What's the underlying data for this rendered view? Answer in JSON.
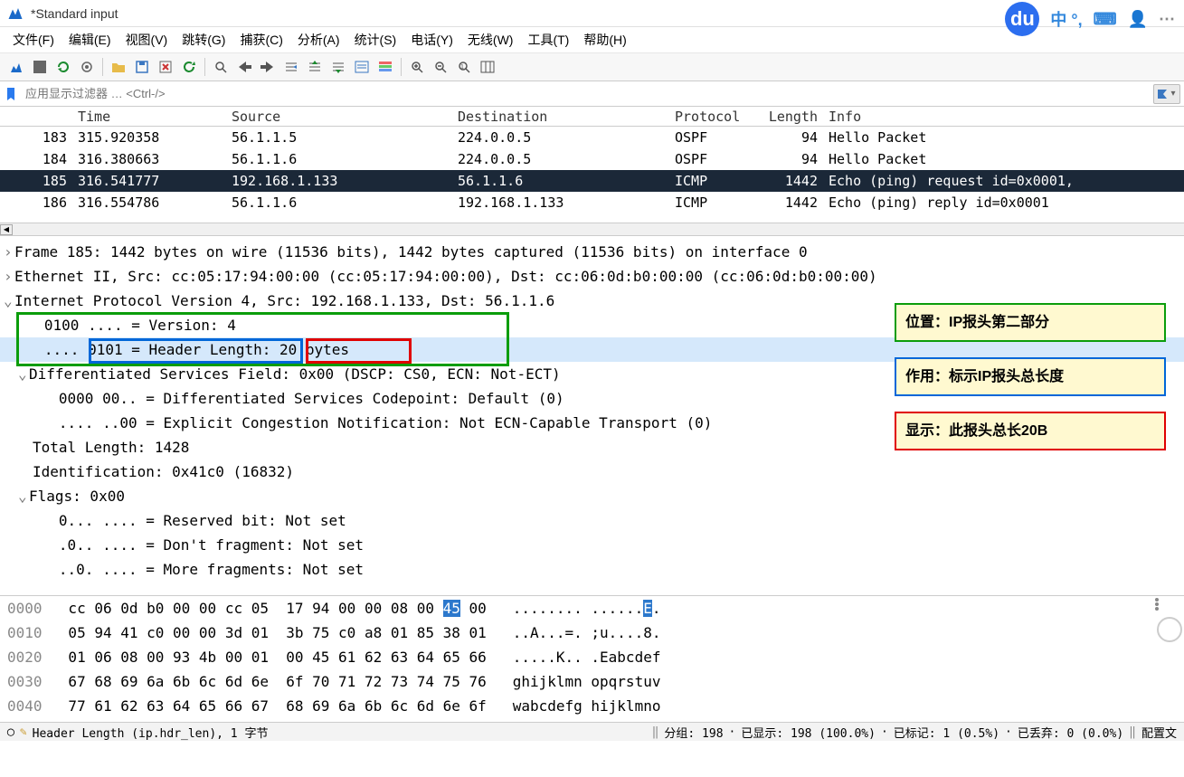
{
  "title": "*Standard input",
  "title_right": {
    "du": "du",
    "ime": "中 °,",
    "kb": "⌨",
    "user": "👤",
    "more": "⋯"
  },
  "menu": [
    "文件(F)",
    "编辑(E)",
    "视图(V)",
    "跳转(G)",
    "捕获(C)",
    "分析(A)",
    "统计(S)",
    "电话(Y)",
    "无线(W)",
    "工具(T)",
    "帮助(H)"
  ],
  "filter_placeholder": "应用显示过滤器 … <Ctrl-/>",
  "columns": [
    "",
    "Time",
    "Source",
    "Destination",
    "Protocol",
    "Length",
    "Info"
  ],
  "packets": [
    {
      "no": "183",
      "time": "315.920358",
      "src": "56.1.1.5",
      "dst": "224.0.0.5",
      "proto": "OSPF",
      "len": "94",
      "info": "Hello Packet"
    },
    {
      "no": "184",
      "time": "316.380663",
      "src": "56.1.1.6",
      "dst": "224.0.0.5",
      "proto": "OSPF",
      "len": "94",
      "info": "Hello Packet"
    },
    {
      "no": "185",
      "time": "316.541777",
      "src": "192.168.1.133",
      "dst": "56.1.1.6",
      "proto": "ICMP",
      "len": "1442",
      "info": "Echo (ping) request  id=0x0001,",
      "sel": true
    },
    {
      "no": "186",
      "time": "316.554786",
      "src": "56.1.1.6",
      "dst": "192.168.1.133",
      "proto": "ICMP",
      "len": "1442",
      "info": "Echo (ping) reply    id=0x0001"
    }
  ],
  "details": {
    "frame": "Frame 185: 1442 bytes on wire (11536 bits), 1442 bytes captured (11536 bits) on interface 0",
    "eth": "Ethernet II, Src: cc:05:17:94:00:00 (cc:05:17:94:00:00), Dst: cc:06:0d:b0:00:00 (cc:06:0d:b0:00:00)",
    "ip": "Internet Protocol Version 4, Src: 192.168.1.133, Dst: 56.1.1.6",
    "version": "   0100 .... = Version: 4",
    "hdr_prefix": "   .... ",
    "hdr_mid": "0101 = Header Length:",
    "hdr_val": " 20 bytes",
    "dsf": "Differentiated Services Field: 0x00 (DSCP: CS0, ECN: Not-ECT)",
    "dscp": "   0000 00.. = Differentiated Services Codepoint: Default (0)",
    "ecn": "   .... ..00 = Explicit Congestion Notification: Not ECN-Capable Transport (0)",
    "total_len": "Total Length: 1428",
    "ident": "Identification: 0x41c0 (16832)",
    "flags": "Flags: 0x00",
    "resv": "   0... .... = Reserved bit: Not set",
    "df": "   .0.. .... = Don't fragment: Not set",
    "mf": "   ..0. .... = More fragments: Not set"
  },
  "annotations": {
    "green": "位置：IP报头第二部分",
    "blue": "作用：标示IP报头总长度",
    "red": "显示：此报头总长20B"
  },
  "hex": [
    {
      "off": "0000",
      "b": "cc 06 0d b0 00 00 cc 05  17 94 00 00 08 00 ",
      "hl": "45",
      "b2": " 00",
      "a": "   ........ ......",
      "ah": "E",
      "a2": "."
    },
    {
      "off": "0010",
      "b": "05 94 41 c0 00 00 3d 01  3b 75 c0 a8 01 85 38 01",
      "a": "   ..A...=. ;u....8."
    },
    {
      "off": "0020",
      "b": "01 06 08 00 93 4b 00 01  00 45 61 62 63 64 65 66",
      "a": "   .....K.. .Eabcdef"
    },
    {
      "off": "0030",
      "b": "67 68 69 6a 6b 6c 6d 6e  6f 70 71 72 73 74 75 76",
      "a": "   ghijklmn opqrstuv"
    },
    {
      "off": "0040",
      "b": "77 61 62 63 64 65 66 67  68 69 6a 6b 6c 6d 6e 6f",
      "a": "   wabcdefg hijklmno"
    }
  ],
  "status": {
    "left_icon": "◯",
    "edit_icon": "✎",
    "field": "Header Length (ip.hdr_len), 1 字节",
    "pkts": "分组: 198",
    "disp": "已显示: 198 (100.0%)",
    "marked": "已标记: 1 (0.5%)",
    "dropped": "已丢弃: 0 (0.0%)",
    "profile": "配置文"
  }
}
